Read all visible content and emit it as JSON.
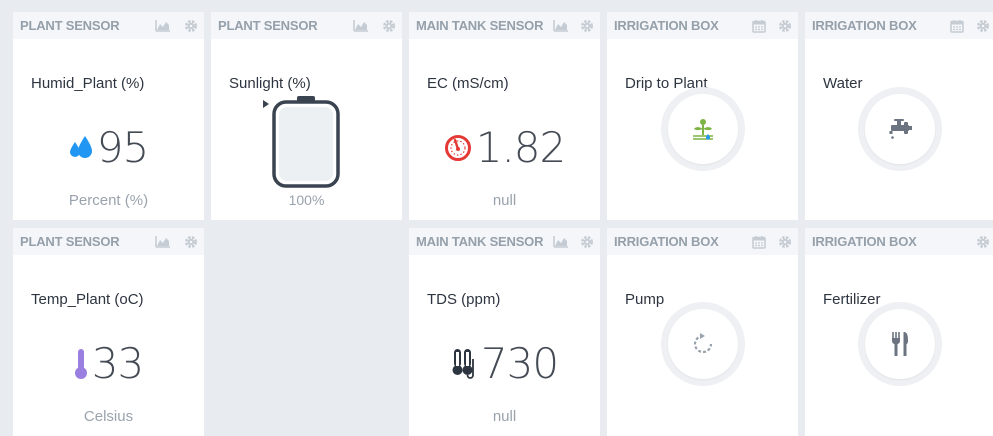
{
  "colors": {
    "background": "#e8ebef",
    "header_bg": "#f4f6f9",
    "header_text": "#95a0ab",
    "drop_blue": "#2196f3",
    "thermo_purple": "#9b7fe0",
    "gauge_red": "#e53935",
    "sprout_green": "#7cb342"
  },
  "widgets": {
    "humid": {
      "header": "PLANT SENSOR",
      "label": "Humid_Plant (%)",
      "value": "95",
      "unit": "Percent (%)",
      "icon": "water-drop-icon"
    },
    "sunlight": {
      "header": "PLANT SENSOR",
      "label": "Sunlight (%)",
      "level_fraction": 1.0,
      "unit": "100%",
      "icon": "tank-gauge-icon"
    },
    "ec": {
      "header": "MAIN TANK SENSOR",
      "label": "EC (mS/cm)",
      "value": "1.82",
      "unit": "null",
      "icon": "gauge-icon"
    },
    "drip": {
      "header": "IRRIGATION BOX",
      "label": "Drip to Plant",
      "icon": "sprout-icon"
    },
    "water": {
      "header": "IRRIGATION BOX",
      "label": "Water",
      "icon": "faucet-icon"
    },
    "temp": {
      "header": "PLANT SENSOR",
      "label": "Temp_Plant (oC)",
      "value": "33",
      "unit": "Celsius",
      "icon": "thermometer-icon"
    },
    "tds": {
      "header": "MAIN TANK SENSOR",
      "label": "TDS (ppm)",
      "value": "730",
      "unit": "null",
      "icon": "probe-icon"
    },
    "pump": {
      "header": "IRRIGATION BOX",
      "label": "Pump",
      "icon": "refresh-icon"
    },
    "fertilizer": {
      "header": "IRRIGATION BOX",
      "label": "Fertilizer",
      "icon": "fork-knife-icon"
    }
  }
}
